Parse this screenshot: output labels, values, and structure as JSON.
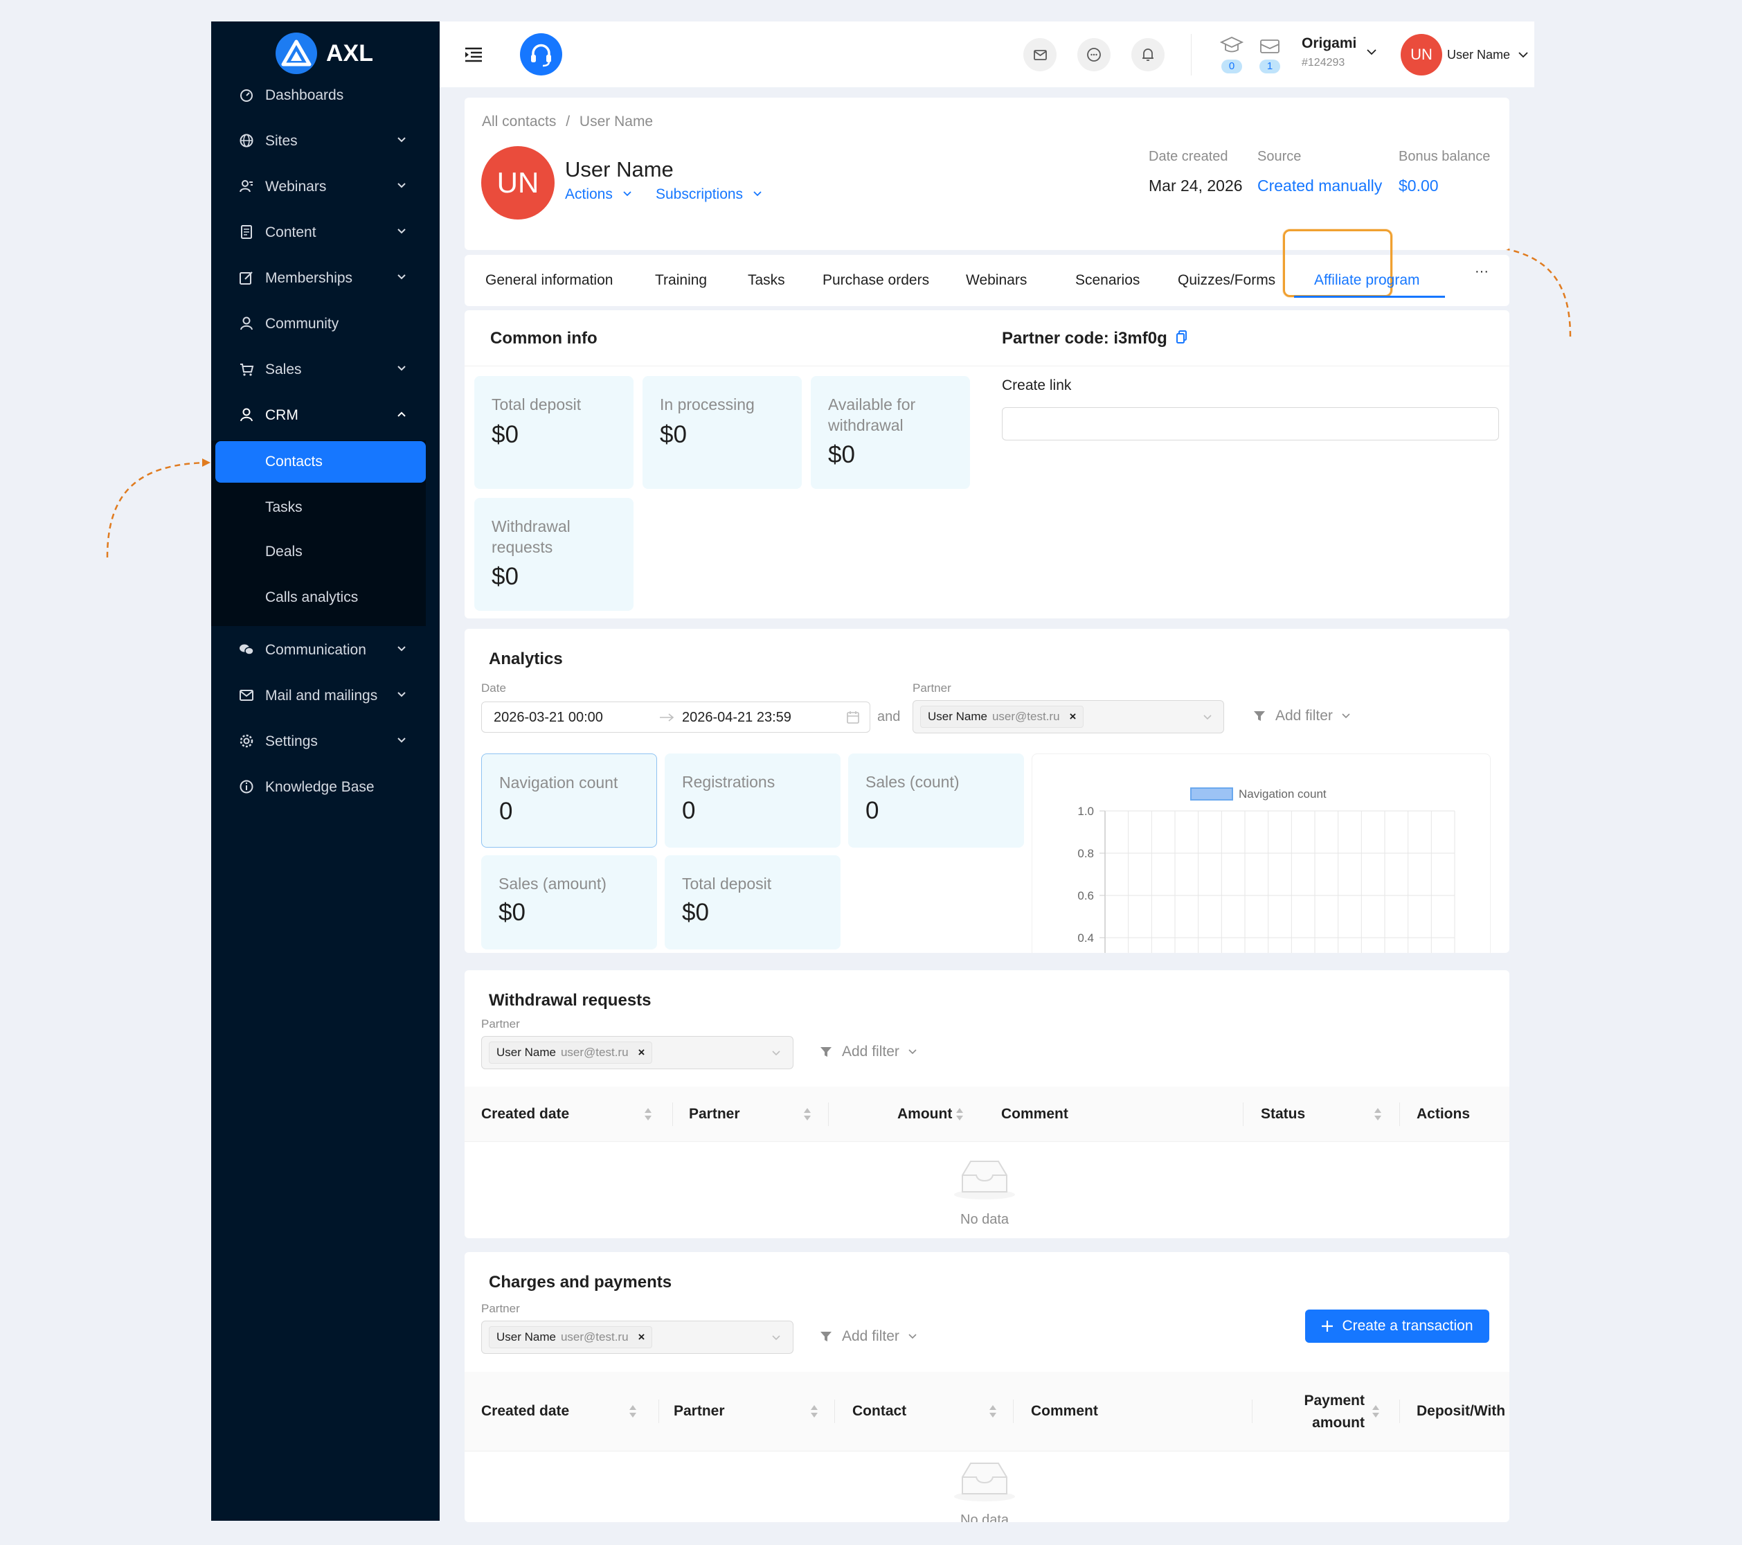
{
  "logo": {
    "text": "AXL"
  },
  "sidebar": {
    "items": [
      {
        "label": "Dashboards",
        "icon": "dashboard-icon"
      },
      {
        "label": "Sites",
        "icon": "globe-icon"
      },
      {
        "label": "Webinars",
        "icon": "webinar-icon"
      },
      {
        "label": "Content",
        "icon": "content-icon"
      },
      {
        "label": "Memberships",
        "icon": "edit-icon"
      },
      {
        "label": "Community",
        "icon": "user-icon"
      },
      {
        "label": "Sales",
        "icon": "cart-icon"
      },
      {
        "label": "CRM",
        "icon": "user-icon"
      },
      {
        "label": "Communication",
        "icon": "chat-icon"
      },
      {
        "label": "Mail and mailings",
        "icon": "mail-icon"
      },
      {
        "label": "Settings",
        "icon": "gear-icon"
      },
      {
        "label": "Knowledge Base",
        "icon": "info-icon"
      }
    ],
    "crm_sub": [
      "Contacts",
      "Tasks",
      "Deals",
      "Calls analytics"
    ]
  },
  "header": {
    "badge_courses": "0",
    "badge_messages": "1",
    "org_name": "Origami",
    "org_id": "#124293",
    "avatar_initials": "UN",
    "user_name": "User Name"
  },
  "breadcrumb": {
    "root": "All contacts",
    "sep": "/",
    "current": "User Name"
  },
  "contact": {
    "initials": "UN",
    "name": "User Name",
    "actions": "Actions",
    "subscriptions": "Subscriptions",
    "date_created_label": "Date created",
    "date_created": "Mar 24, 2026",
    "source_label": "Source",
    "source": "Created manually",
    "bonus_label": "Bonus balance",
    "bonus": "$0.00"
  },
  "tabs": [
    "General information",
    "Training",
    "Tasks",
    "Purchase orders",
    "Webinars",
    "Scenarios",
    "Quizzes/Forms",
    "Affiliate program"
  ],
  "tabs_more": "···",
  "common_info": {
    "title": "Common info",
    "partner_code": "Partner code: i3mf0g",
    "create_link": "Create link",
    "tiles": [
      {
        "label": "Total deposit",
        "value": "$0"
      },
      {
        "label": "In processing",
        "value": "$0"
      },
      {
        "label": "Available for withdrawal",
        "value": "$0"
      },
      {
        "label": "Withdrawal requests",
        "value": "$0"
      }
    ]
  },
  "analytics": {
    "title": "Analytics",
    "date_label": "Date",
    "date_from": "2026-03-21 00:00",
    "date_to": "2026-04-21 23:59",
    "and": "and",
    "partner_label": "Partner",
    "partner_name": "User Name",
    "partner_email": "user@test.ru",
    "add_filter": "Add filter",
    "tiles": [
      {
        "label": "Navigation count",
        "value": "0"
      },
      {
        "label": "Registrations",
        "value": "0"
      },
      {
        "label": "Sales (count)",
        "value": "0"
      },
      {
        "label": "Sales (amount)",
        "value": "$0"
      },
      {
        "label": "Total deposit",
        "value": "$0"
      }
    ]
  },
  "chart_data": {
    "type": "line",
    "series": [
      {
        "name": "Navigation count",
        "values": []
      }
    ],
    "y_ticks": [
      "1.0",
      "0.8",
      "0.6",
      "0.4"
    ],
    "ylim": [
      0.4,
      1.0
    ],
    "grid": true,
    "legend": "top",
    "color": "#9cc3f5"
  },
  "withdrawals": {
    "title": "Withdrawal requests",
    "partner_label": "Partner",
    "partner_name": "User Name",
    "partner_email": "user@test.ru",
    "add_filter": "Add filter",
    "columns": [
      "Created date",
      "Partner",
      "Amount",
      "Comment",
      "Status",
      "Actions"
    ],
    "empty": "No data"
  },
  "charges": {
    "title": "Charges and payments",
    "partner_label": "Partner",
    "partner_name": "User Name",
    "partner_email": "user@test.ru",
    "add_filter": "Add filter",
    "create_button": "Create a transaction",
    "columns": [
      "Created date",
      "Partner",
      "Contact",
      "Comment",
      "Payment amount",
      "Deposit/With"
    ],
    "empty": "No data"
  },
  "colors": {
    "primary": "#1677ff",
    "sidebar": "#001529",
    "avatar": "#ea4c3c",
    "highlight": "#f0a030",
    "tile": "#eef9fd"
  }
}
